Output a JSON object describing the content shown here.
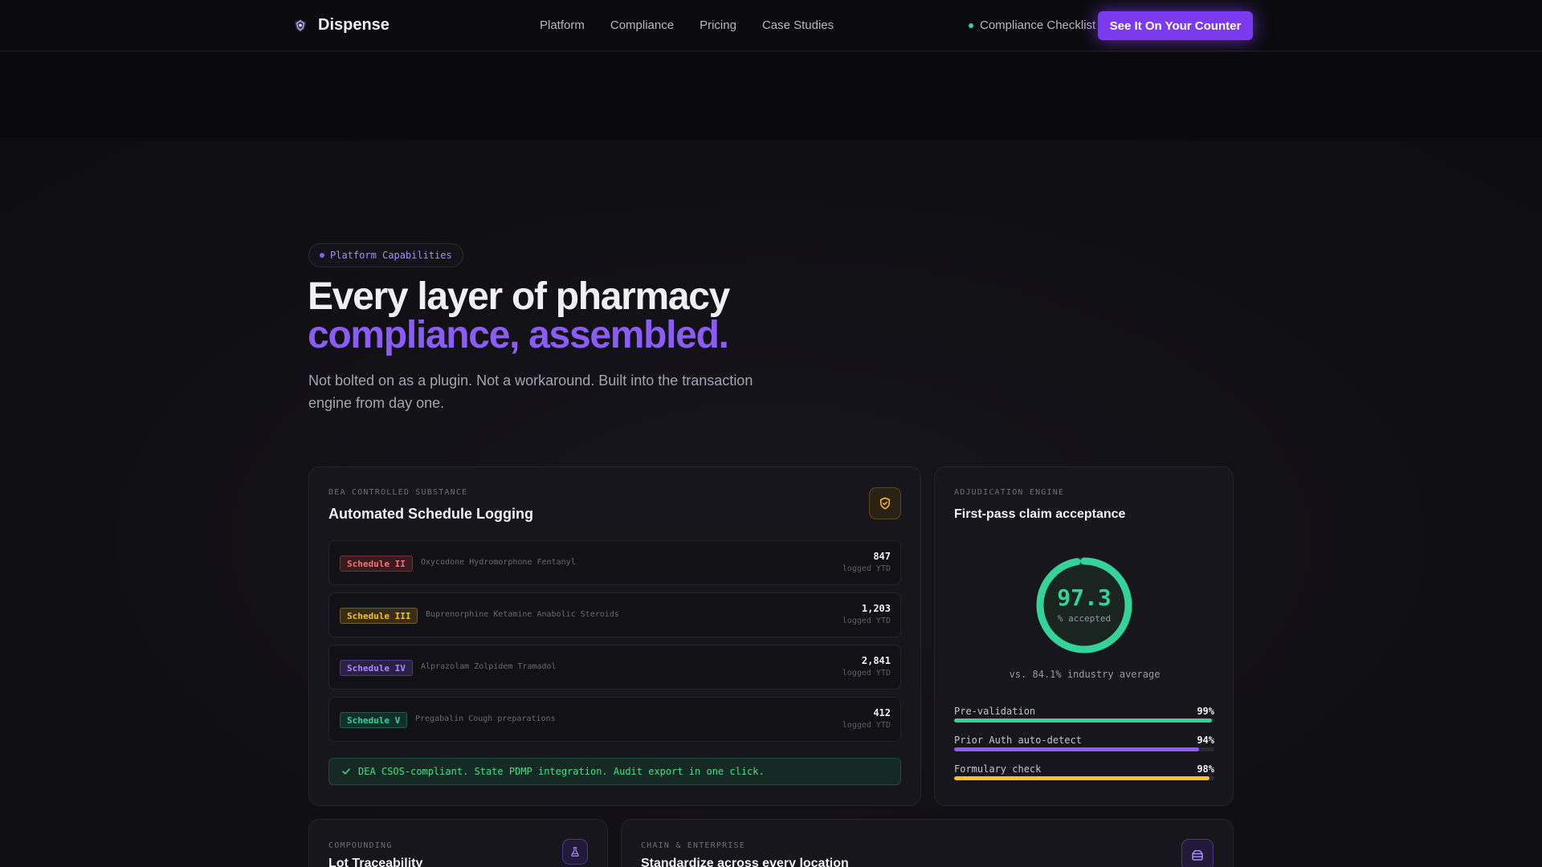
{
  "nav": {
    "brand": "Dispense",
    "links": [
      "Platform",
      "Compliance",
      "Pricing",
      "Case Studies"
    ],
    "checklist": "Compliance Checklist",
    "cta": "See It On Your Counter"
  },
  "hero": {
    "pill": "Platform Capabilities",
    "title_line1": "Every layer of pharmacy",
    "title_line2": "compliance, assembled.",
    "subtitle": "Not bolted on as a plugin. Not a workaround. Built into the transaction engine from day one."
  },
  "schedule_card": {
    "eyebrow": "DEA CONTROLLED SUBSTANCE",
    "title": "Automated Schedule Logging",
    "icon": "shield-check-icon",
    "rows": [
      {
        "badge": "Schedule II",
        "drugs": "Oxycodone Hydromorphone Fentanyl",
        "count": "847",
        "sub": "logged YTD",
        "color": "#f87171"
      },
      {
        "badge": "Schedule III",
        "drugs": "Buprenorphine Ketamine Anabolic Steroids",
        "count": "1,203",
        "sub": "logged YTD",
        "color": "#fbbf24"
      },
      {
        "badge": "Schedule IV",
        "drugs": "Alprazolam Zolpidem Tramadol",
        "count": "2,841",
        "sub": "logged YTD",
        "color": "#a78bfa"
      },
      {
        "badge": "Schedule V",
        "drugs": "Pregabalin Cough preparations",
        "count": "412",
        "sub": "logged YTD",
        "color": "#34d399"
      }
    ],
    "footer": "DEA CSOS-compliant. State PDMP integration. Audit export in one click."
  },
  "adjudication_card": {
    "eyebrow": "ADJUDICATION ENGINE",
    "title": "First-pass claim acceptance",
    "ring_value": "97.3",
    "ring_value_fraction": 0.973,
    "ring_label": "% accepted",
    "comparison": "vs. 84.1% industry average",
    "metrics": [
      {
        "label": "Pre-validation",
        "value": "99%",
        "fraction": 0.99,
        "color": "#34d399"
      },
      {
        "label": "Prior Auth auto-detect",
        "value": "94%",
        "fraction": 0.94,
        "color": "#8b5cf6"
      },
      {
        "label": "Formulary check",
        "value": "98%",
        "fraction": 0.98,
        "color": "#fbbf24"
      }
    ]
  },
  "compounding_card": {
    "eyebrow": "COMPOUNDING",
    "title": "Lot Traceability",
    "icon": "flask-icon"
  },
  "enterprise_card": {
    "eyebrow": "CHAIN & ENTERPRISE",
    "title": "Standardize across every location",
    "icon": "stack-icon"
  },
  "colors": {
    "accent": "#7c3aed",
    "accent_text": "#8b5cf6",
    "success": "#34d399",
    "warning": "#fbbf24",
    "danger": "#f87171"
  }
}
